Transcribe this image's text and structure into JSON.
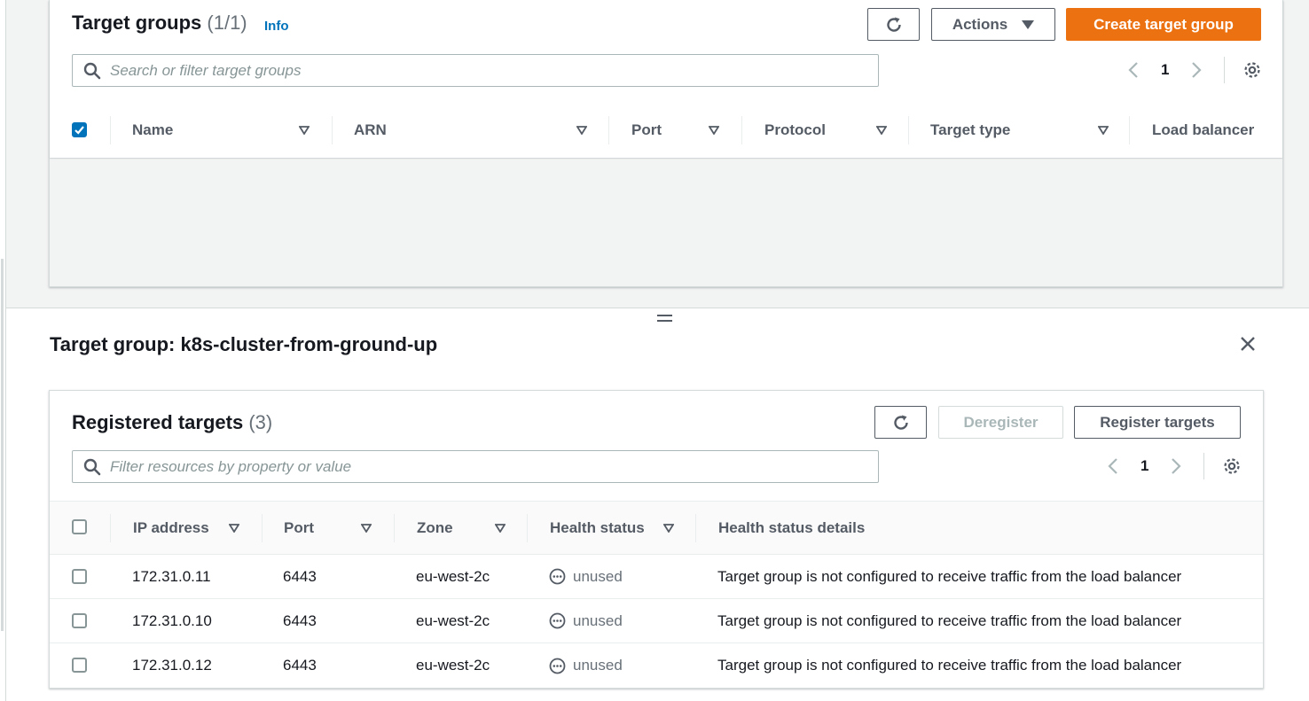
{
  "target_groups": {
    "title": "Target groups",
    "count": "(1/1)",
    "info_link": "Info",
    "actions_label": "Actions",
    "create_label": "Create target group",
    "search_placeholder": "Search or filter target groups",
    "page": "1",
    "columns": [
      "Name",
      "ARN",
      "Port",
      "Protocol",
      "Target type",
      "Load balancer"
    ],
    "select_all_checked": true
  },
  "detail": {
    "title": "Target group: k8s-cluster-from-ground-up"
  },
  "registered_targets": {
    "title": "Registered targets",
    "count": "(3)",
    "deregister_label": "Deregister",
    "register_label": "Register targets",
    "search_placeholder": "Filter resources by property or value",
    "page": "1",
    "columns": [
      "IP address",
      "Port",
      "Zone",
      "Health status",
      "Health status details"
    ],
    "rows": [
      {
        "ip": "172.31.0.11",
        "port": "6443",
        "zone": "eu-west-2c",
        "health": "unused",
        "details": "Target group is not configured to receive traffic from the load balancer"
      },
      {
        "ip": "172.31.0.10",
        "port": "6443",
        "zone": "eu-west-2c",
        "health": "unused",
        "details": "Target group is not configured to receive traffic from the load balancer"
      },
      {
        "ip": "172.31.0.12",
        "port": "6443",
        "zone": "eu-west-2c",
        "health": "unused",
        "details": "Target group is not configured to receive traffic from the load balancer"
      }
    ]
  },
  "icons": {
    "refresh": "refresh-icon",
    "search": "search-icon",
    "settings": "gear-icon",
    "close": "close-icon",
    "prev": "chevron-left-icon",
    "next": "chevron-right-icon",
    "sort": "sort-caret-icon",
    "status": "ellipsis-circle-icon"
  },
  "colors": {
    "primary_button": "#ec7211",
    "link": "#0073bb",
    "checkbox_checked": "#0073bb"
  }
}
